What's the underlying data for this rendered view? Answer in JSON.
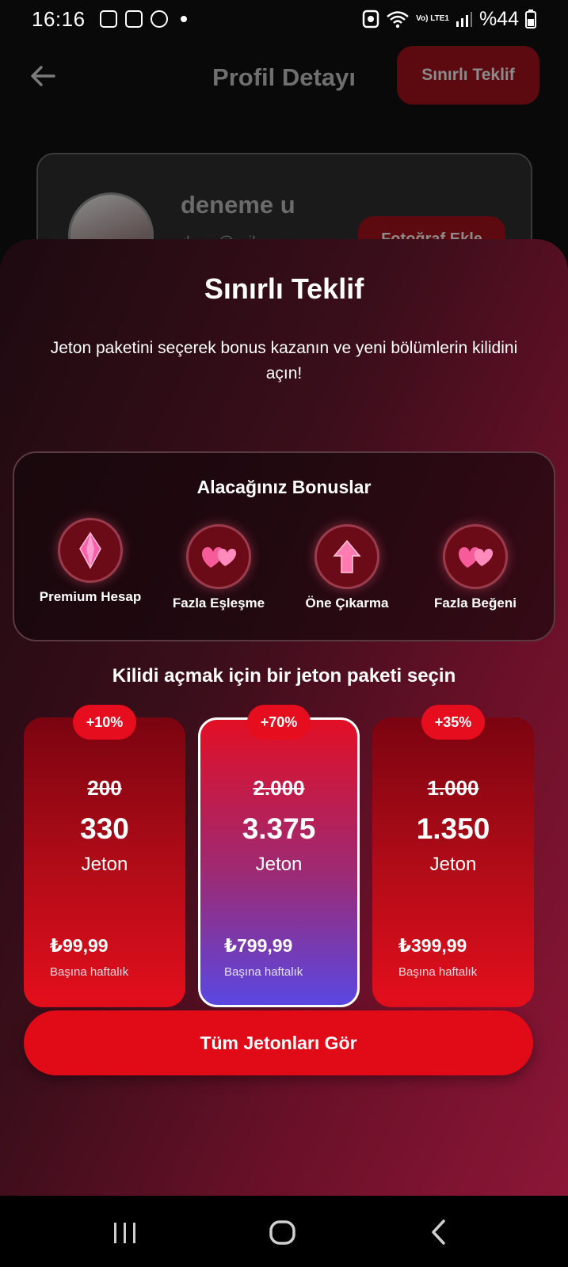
{
  "status_bar": {
    "time": "16:16",
    "icons": [
      "gallery-icon",
      "instagram-icon",
      "whatsapp-icon",
      "notification-dot-icon"
    ],
    "network": "Vo) LTE1",
    "battery": "%44"
  },
  "header": {
    "title": "Profil Detayı",
    "limited_offer_label": "Sınırlı Teklif",
    "back_icon": "arrow-left-icon"
  },
  "profile": {
    "name": "deneme u",
    "email": "d......@...il",
    "add_photo_label": "Fotoğraf Ekle"
  },
  "offer_sheet": {
    "title": "Sınırlı Teklif",
    "subtitle": "Jeton paketini seçerek bonus kazanın ve yeni bölümlerin kilidini açın!",
    "bonuses_title": "Alacağınız Bonuslar",
    "bonuses": [
      {
        "label": "Premium Hesap",
        "icon": "crystal-icon"
      },
      {
        "label": "Fazla Eşleşme",
        "icon": "hearts-icon"
      },
      {
        "label": "Öne Çıkarma",
        "icon": "boost-arrow-icon"
      },
      {
        "label": "Fazla Beğeni",
        "icon": "hearts-icon"
      }
    ],
    "choose_title": "Kilidi açmak için bir jeton paketi seçin",
    "packages": [
      {
        "badge": "+10%",
        "old": "200",
        "amount": "330",
        "unit": "Jeton",
        "price": "₺99,99",
        "period": "Başına haftalık",
        "selected": false
      },
      {
        "badge": "+70%",
        "old": "2.000",
        "amount": "3.375",
        "unit": "Jeton",
        "price": "₺799,99",
        "period": "Başına haftalık",
        "selected": true
      },
      {
        "badge": "+35%",
        "old": "1.000",
        "amount": "1.350",
        "unit": "Jeton",
        "price": "₺399,99",
        "period": "Başına haftalık",
        "selected": false
      }
    ],
    "cta_label": "Tüm Jetonları Gör"
  },
  "nav_bar": {
    "buttons": [
      "recent-apps-icon",
      "home-icon",
      "back-icon"
    ]
  },
  "colors": {
    "accent": "#e10b17",
    "featured_top": "#e20f25",
    "featured_bottom": "#5a47e2",
    "sheet_dark": "#1d0a10",
    "sheet_light": "#8c1637"
  }
}
